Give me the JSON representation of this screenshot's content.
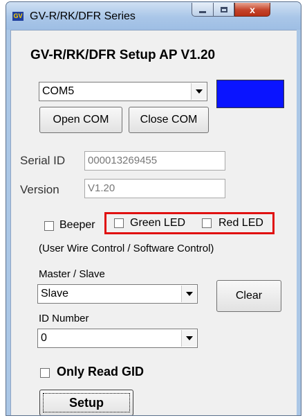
{
  "window": {
    "title": "GV-R/RK/DFR Series",
    "icon_label": "GV",
    "controls": {
      "minimize": "minimize",
      "maximize": "maximize",
      "close": "x"
    }
  },
  "app": {
    "heading": "GV-R/RK/DFR Setup AP   V1.20"
  },
  "com": {
    "port_selected": "COM5",
    "status_color": "#0a14ff",
    "open_label": "Open COM",
    "close_label": "Close COM"
  },
  "device": {
    "serial_label": "Serial ID",
    "serial_value": "000013269455",
    "version_label": "Version",
    "version_value": "V1.20"
  },
  "options": {
    "beeper_label": "Beeper",
    "green_led_label": "Green LED",
    "red_led_label": "Red LED",
    "control_note": "(User Wire Control / Software Control)"
  },
  "mode": {
    "master_slave_label": "Master / Slave",
    "master_slave_value": "Slave",
    "clear_label": "Clear",
    "id_number_label": "ID Number",
    "id_number_value": "0"
  },
  "footer": {
    "only_read_label": "Only Read  GID",
    "setup_label": "Setup"
  },
  "colors": {
    "highlight": "#e01010",
    "titlebar": "#abc7e6"
  }
}
